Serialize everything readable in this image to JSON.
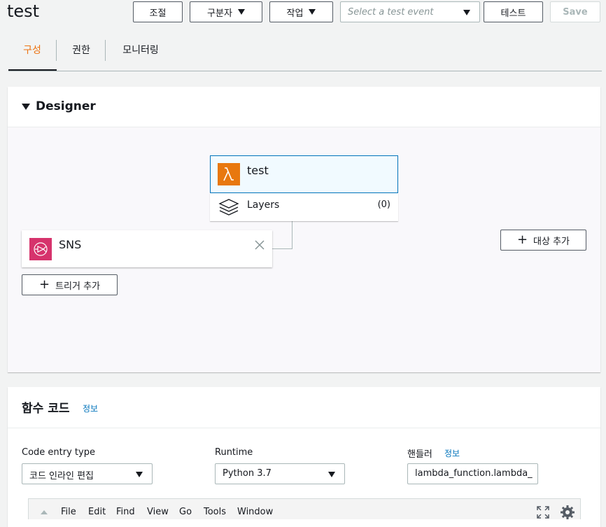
{
  "header": {
    "title": "test",
    "buttons": {
      "throttle": "조절",
      "qualifier": "구분자",
      "actions": "작업",
      "test": "테스트",
      "save": "Save"
    },
    "test_event_placeholder": "Select a test event"
  },
  "tabs": [
    {
      "label": "구성",
      "active": true
    },
    {
      "label": "권한",
      "active": false
    },
    {
      "label": "모니터링",
      "active": false
    }
  ],
  "designer": {
    "title": "Designer",
    "function_name": "test",
    "layers_label": "Layers",
    "layers_count": "(0)",
    "trigger_name": "SNS",
    "add_trigger": "트리거 추가",
    "add_destination": "대상 추가"
  },
  "code": {
    "title": "함수 코드",
    "info_link": "정보",
    "entry_type_label": "Code entry type",
    "entry_type_value": "코드 인라인 편집",
    "runtime_label": "Runtime",
    "runtime_value": "Python 3.7",
    "handler_label": "핸들러",
    "handler_info": "정보",
    "handler_value": "lambda_function.lambda_",
    "editor_menu": [
      "File",
      "Edit",
      "Find",
      "View",
      "Go",
      "Tools",
      "Window"
    ]
  },
  "colors": {
    "accent": "#ec7211",
    "link": "#0073bb",
    "lambda_orange": "#e8780f",
    "sns_pink": "#d6336c",
    "selected_bg": "#f1faff",
    "selected_border": "#0073bb"
  }
}
